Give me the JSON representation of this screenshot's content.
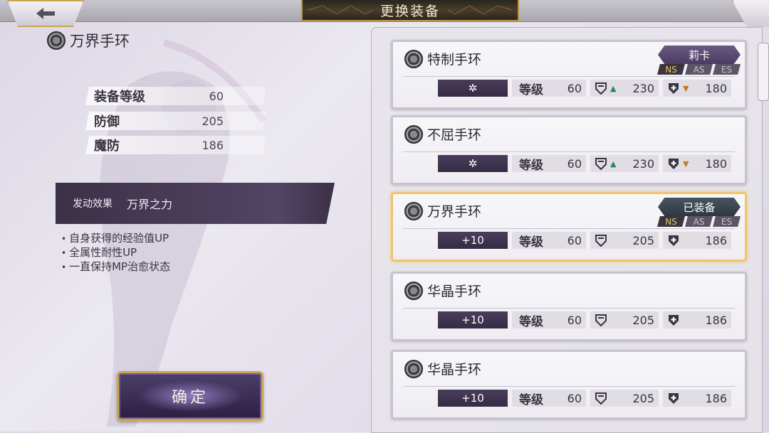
{
  "header": {
    "title": "更换装备"
  },
  "left": {
    "item_name": "万界手环",
    "stats": [
      {
        "label": "装备等级",
        "value": "60"
      },
      {
        "label": "防御",
        "value": "205"
      },
      {
        "label": "魔防",
        "value": "186"
      }
    ],
    "effect_key": "发动效果",
    "effect_name": "万界之力",
    "effects": [
      "自身获得的经验值UP",
      "全属性耐性UP",
      "一直保持MP治愈状态"
    ],
    "confirm_label": "确定"
  },
  "list": {
    "level_label": "等级",
    "cards": [
      {
        "name": "特制手环",
        "badge": "莉卡",
        "tags": [
          "NS",
          "AS",
          "ES"
        ],
        "refine": "✲",
        "level": "60",
        "def": "230",
        "def_change": "up",
        "mdef": "180",
        "mdef_change": "down"
      },
      {
        "name": "不屈手环",
        "badge": "",
        "tags": [],
        "refine": "✲",
        "level": "60",
        "def": "230",
        "def_change": "up",
        "mdef": "180",
        "mdef_change": "down"
      },
      {
        "name": "万界手环",
        "badge": "已装备",
        "tags": [
          "NS",
          "AS",
          "ES"
        ],
        "refine": "+10",
        "level": "60",
        "def": "205",
        "def_change": "",
        "mdef": "186",
        "mdef_change": ""
      },
      {
        "name": "华晶手环",
        "badge": "",
        "tags": [],
        "refine": "+10",
        "level": "60",
        "def": "205",
        "def_change": "",
        "mdef": "186",
        "mdef_change": ""
      },
      {
        "name": "华晶手环",
        "badge": "",
        "tags": [],
        "refine": "+10",
        "level": "60",
        "def": "205",
        "def_change": "",
        "mdef": "186",
        "mdef_change": ""
      }
    ]
  }
}
